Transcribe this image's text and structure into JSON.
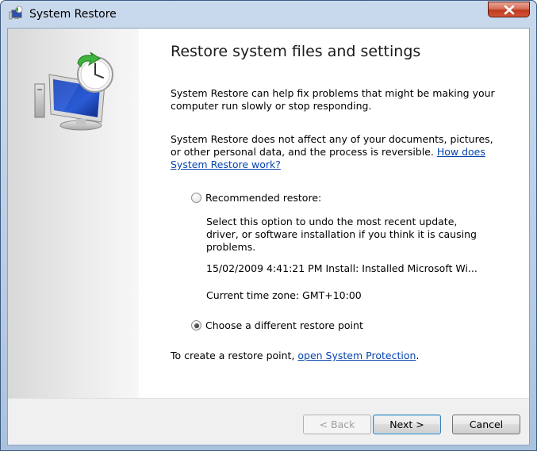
{
  "window": {
    "title": "System Restore",
    "close_icon": "close-x-icon",
    "app_icon": "system-restore-icon"
  },
  "content": {
    "heading": "Restore system files and settings",
    "para1": "System Restore can help fix problems that might be making your computer run slowly or stop responding.",
    "para2_text": "System Restore does not affect any of your documents, pictures, or other personal data, and the process is reversible. ",
    "para2_link": "How does System Restore work?",
    "recommended_label": "Recommended restore:",
    "recommended_desc": "Select this option to undo the most recent update, driver, or software installation if you think it is causing problems.",
    "restore_point": "15/02/2009 4:41:21 PM Install: Installed Microsoft Wi...",
    "timezone": "Current time zone: GMT+10:00",
    "different_label": "Choose a different restore point",
    "selected_option": "Choose a different restore point",
    "create_text": "To create a restore point, ",
    "create_link": "open System Protection",
    "create_end": "."
  },
  "buttons": {
    "back": "< Back",
    "next": "Next >",
    "cancel": "Cancel"
  },
  "colors": {
    "link": "#0645ad",
    "title_bar": "#c9d9ec",
    "close_button": "#c0391f"
  }
}
